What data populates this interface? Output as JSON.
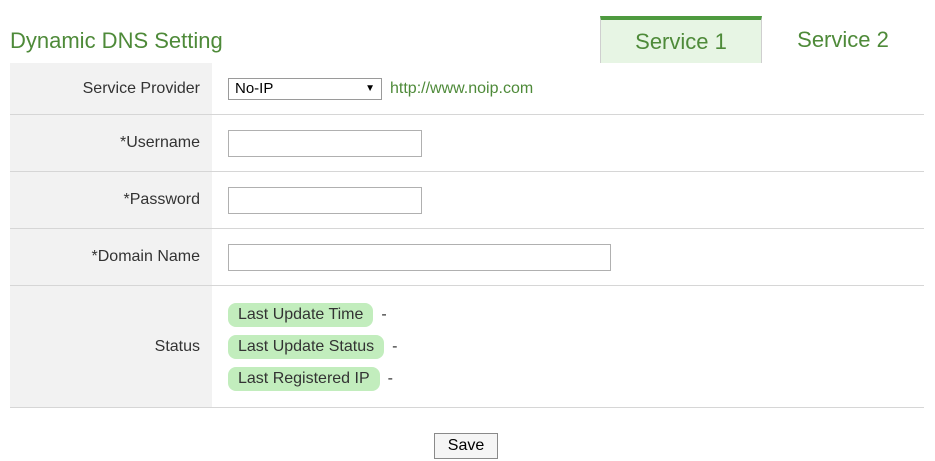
{
  "header": {
    "title": "Dynamic DNS Setting",
    "tabs": [
      {
        "label": "Service 1",
        "active": true
      },
      {
        "label": "Service 2",
        "active": false
      }
    ]
  },
  "form": {
    "provider": {
      "label": "Service Provider",
      "selected": "No-IP",
      "link": "http://www.noip.com"
    },
    "username": {
      "label": "*Username",
      "value": ""
    },
    "password": {
      "label": "*Password",
      "value": ""
    },
    "domain": {
      "label": "*Domain Name",
      "value": ""
    },
    "status": {
      "label": "Status",
      "items": [
        {
          "label": "Last Update Time",
          "value": "-"
        },
        {
          "label": "Last Update Status",
          "value": "-"
        },
        {
          "label": "Last Registered IP",
          "value": "-"
        }
      ]
    }
  },
  "actions": {
    "save_label": "Save"
  },
  "colors": {
    "accent": "#4e8a39",
    "badge": "#c2edbd",
    "tab_active_bg": "#e7f5e4"
  }
}
